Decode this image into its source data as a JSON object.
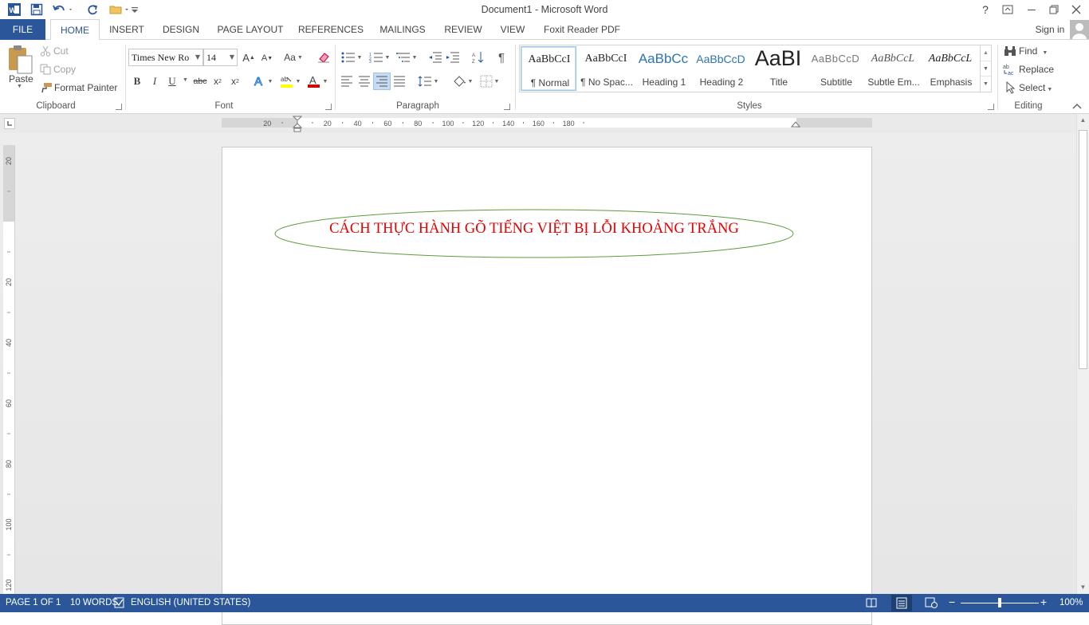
{
  "app": {
    "title": "Document1 - Microsoft Word",
    "help": "?",
    "signin": "Sign in"
  },
  "tabs": [
    "FILE",
    "HOME",
    "INSERT",
    "DESIGN",
    "PAGE LAYOUT",
    "REFERENCES",
    "MAILINGS",
    "REVIEW",
    "VIEW",
    "Foxit Reader PDF"
  ],
  "clipboard": {
    "paste": "Paste",
    "cut": "Cut",
    "copy": "Copy",
    "format_painter": "Format Painter",
    "group": "Clipboard"
  },
  "font": {
    "name": "Times New Ro",
    "size": "14",
    "change_case": "Aa",
    "bold": "B",
    "italic": "I",
    "underline": "U",
    "strikethrough": "abc",
    "subscript": "x",
    "superscript": "x",
    "group": "Font",
    "font_color": "#d00000",
    "highlight_color": "#ffff00"
  },
  "paragraph": {
    "group": "Paragraph",
    "show_marks": "¶"
  },
  "styles": {
    "group": "Styles",
    "items": [
      {
        "sample": "AaBbCcI",
        "name": "¶ Normal"
      },
      {
        "sample": "AaBbCcI",
        "name": "¶ No Spac..."
      },
      {
        "sample": "AaBbCc",
        "name": "Heading 1"
      },
      {
        "sample": "AaBbCcD",
        "name": "Heading 2"
      },
      {
        "sample": "AaBI",
        "name": "Title"
      },
      {
        "sample": "AaBbCcD",
        "name": "Subtitle"
      },
      {
        "sample": "AaBbCcL",
        "name": "Subtle Em..."
      },
      {
        "sample": "AaBbCcL",
        "name": "Emphasis"
      }
    ]
  },
  "editing": {
    "find": "Find",
    "replace": "Replace",
    "select": "Select",
    "group": "Editing"
  },
  "ruler": {
    "h_labels": [
      "20",
      "20",
      "40",
      "60",
      "80",
      "100",
      "120",
      "140",
      "160",
      "180"
    ],
    "v_labels": [
      "20",
      "20",
      "40",
      "60",
      "80",
      "100",
      "120"
    ]
  },
  "document": {
    "heading": "CÁCH THỰC HÀNH GÕ TIẾNG VIỆT BỊ LỖI KHOẢNG TRẮNG",
    "heading_color": "#e30000",
    "ellipse_color": "#5a9e3a"
  },
  "status": {
    "page": "PAGE 1 OF 1",
    "words": "10 WORDS",
    "language": "ENGLISH (UNITED STATES)",
    "zoom": "100%",
    "zoom_level": 1.0
  },
  "colors": {
    "accent": "#2b579a"
  }
}
